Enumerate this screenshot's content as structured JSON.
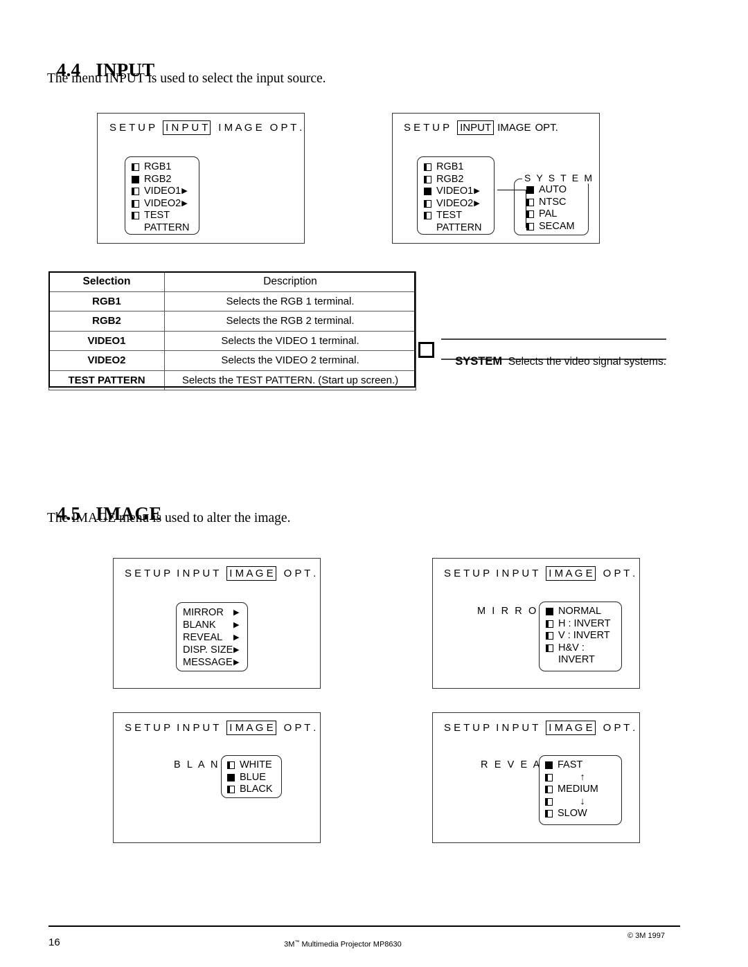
{
  "sections": {
    "input": {
      "number": "4.4",
      "title": "INPUT",
      "intro": "The menu INPUT is used to select the input source."
    },
    "image": {
      "number": "4.5",
      "title": "IMAGE",
      "intro": "The IMAGE menu is used to alter the image."
    }
  },
  "osd": {
    "tabs_input": {
      "t1": "S E T U P",
      "t2": "I N P U T",
      "t3": "I M A G E",
      "t4": "O P T ."
    },
    "tabs_input_compact": {
      "t1": "S E T U P",
      "t2": "INPUT",
      "t3": "IMAGE",
      "t4": "OPT."
    },
    "tabs_image": {
      "t1": "S E T U P",
      "t2": "I N P U T",
      "t3": "I M A G E",
      "t4": "O P T ."
    }
  },
  "panel_input_1": {
    "items": [
      {
        "label": "RGB1",
        "selected": false,
        "arrow": false
      },
      {
        "label": "RGB2",
        "selected": true,
        "arrow": false
      },
      {
        "label": "VIDEO1",
        "selected": false,
        "arrow": true
      },
      {
        "label": "VIDEO2",
        "selected": false,
        "arrow": true
      },
      {
        "label": "TEST",
        "selected": false,
        "arrow": false
      },
      {
        "label": "PATTERN",
        "selected": false,
        "arrow": false,
        "nocheck": true
      }
    ]
  },
  "panel_input_2": {
    "items": [
      {
        "label": "RGB1",
        "selected": false,
        "arrow": false
      },
      {
        "label": "RGB2",
        "selected": false,
        "arrow": false
      },
      {
        "label": "VIDEO1",
        "selected": true,
        "arrow": true
      },
      {
        "label": "VIDEO2",
        "selected": false,
        "arrow": true
      },
      {
        "label": "TEST",
        "selected": false,
        "arrow": false
      },
      {
        "label": "PATTERN",
        "selected": false,
        "arrow": false,
        "nocheck": true
      }
    ],
    "system": {
      "legend": "S Y S T E M",
      "items": [
        {
          "label": "AUTO",
          "selected": true
        },
        {
          "label": "NTSC",
          "selected": false
        },
        {
          "label": "PAL",
          "selected": false
        },
        {
          "label": "SECAM",
          "selected": false
        }
      ]
    }
  },
  "table": {
    "headers": {
      "selection": "Selection",
      "description": "Description"
    },
    "rows": [
      {
        "selection": "RGB1",
        "description": "Selects the RGB 1 terminal."
      },
      {
        "selection": "RGB2",
        "description": "Selects the RGB 2 terminal."
      },
      {
        "selection": "VIDEO1",
        "description": "Selects the VIDEO 1 terminal."
      },
      {
        "selection": "VIDEO2",
        "description": "Selects the VIDEO 2 terminal."
      },
      {
        "selection": "TEST PATTERN",
        "description": "Selects the TEST PATTERN. (Start up screen.)"
      }
    ]
  },
  "system_note": {
    "term": "SYSTEM",
    "description": "Selects the video signal systems."
  },
  "panel_image_main": {
    "items": [
      {
        "label": "MIRROR",
        "arrow": true
      },
      {
        "label": "BLANK",
        "arrow": true
      },
      {
        "label": "REVEAL",
        "arrow": true
      },
      {
        "label": "DISP. SIZE",
        "arrow": true
      },
      {
        "label": "MESSAGE",
        "arrow": true
      }
    ]
  },
  "panel_image_mirror": {
    "label": "M I R R O R",
    "items": [
      {
        "label": "NORMAL",
        "selected": true
      },
      {
        "label": "H : INVERT",
        "selected": false
      },
      {
        "label": "V : INVERT",
        "selected": false
      },
      {
        "label": "H&V :",
        "selected": false
      },
      {
        "label": "INVERT",
        "selected": false,
        "nocheck": true
      }
    ]
  },
  "panel_image_blank": {
    "label": "B L A N K",
    "items": [
      {
        "label": "WHITE",
        "selected": false
      },
      {
        "label": "BLUE",
        "selected": true
      },
      {
        "label": "BLACK",
        "selected": false
      }
    ]
  },
  "panel_image_reveal": {
    "label": "R E V E A L",
    "items": [
      {
        "label": "FAST",
        "selected": true
      },
      {
        "label": "↑",
        "selected": false,
        "center": true
      },
      {
        "label": "MEDIUM",
        "selected": false
      },
      {
        "label": "↓",
        "selected": false,
        "center": true
      },
      {
        "label": "SLOW",
        "selected": false
      }
    ]
  },
  "footer": {
    "page": "16",
    "center_pre": "3M",
    "center_tm": "™",
    "center_post": " Multimedia Projector MP8630",
    "copyright": "© 3M 1997"
  }
}
